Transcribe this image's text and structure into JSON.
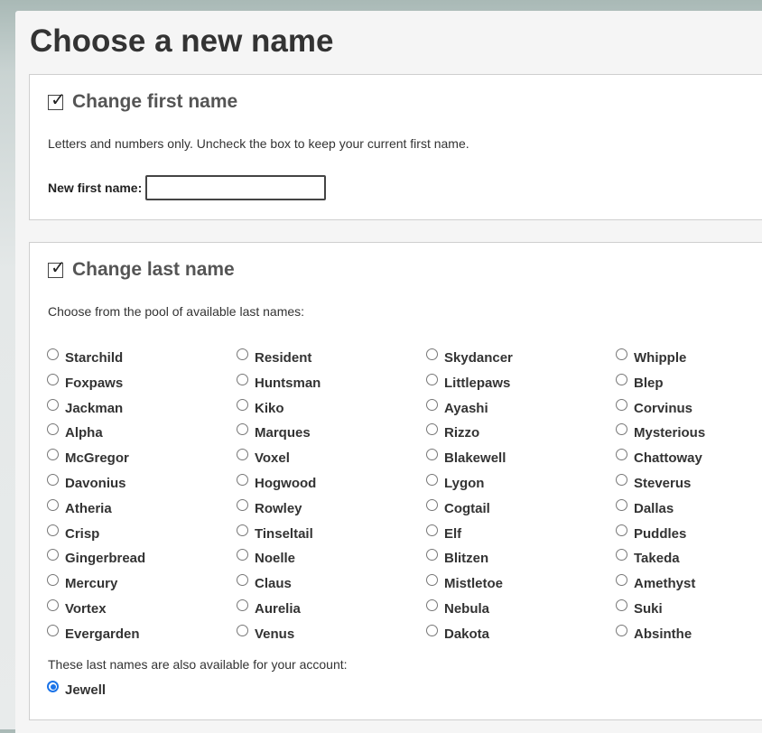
{
  "page_title": "Choose a new name",
  "first_name": {
    "title": "Change first name",
    "checked": true,
    "description": "Letters and numbers only. Uncheck the box to keep your current first name.",
    "field_label": "New first name:",
    "field_value": ""
  },
  "last_name": {
    "title": "Change last name",
    "checked": true,
    "pool_label": "Choose from the pool of available last names:",
    "options": [
      "Starchild",
      "Resident",
      "Skydancer",
      "Whipple",
      "Foxpaws",
      "Huntsman",
      "Littlepaws",
      "Blep",
      "Jackman",
      "Kiko",
      "Ayashi",
      "Corvinus",
      "Alpha",
      "Marques",
      "Rizzo",
      "Mysterious",
      "McGregor",
      "Voxel",
      "Blakewell",
      "Chattoway",
      "Davonius",
      "Hogwood",
      "Lygon",
      "Steverus",
      "Atheria",
      "Rowley",
      "Cogtail",
      "Dallas",
      "Crisp",
      "Tinseltail",
      "Elf",
      "Puddles",
      "Gingerbread",
      "Noelle",
      "Blitzen",
      "Takeda",
      "Mercury",
      "Claus",
      "Mistletoe",
      "Amethyst",
      "Vortex",
      "Aurelia",
      "Nebula",
      "Suki",
      "Evergarden",
      "Venus",
      "Dakota",
      "Absinthe"
    ],
    "also_available_label": "These last names are also available for your account:",
    "also_available": [
      {
        "name": "Jewell",
        "selected": true
      }
    ]
  },
  "colors": {
    "accent": "#1a73e8"
  },
  "icons": {
    "checkbox": "checkmark-icon"
  }
}
